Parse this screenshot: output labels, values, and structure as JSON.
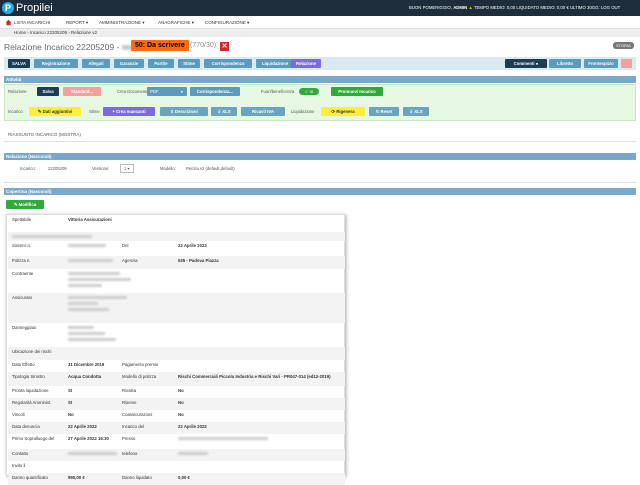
{
  "app": {
    "brand": "Propilei",
    "user_area": "BUON POMERIGGIO,",
    "user_name": "ADMIN",
    "stats": "TEMPO MEDIO: 0,00 LIQUIDATO MEDIO: 0,00 € ULTIMO 30GG:",
    "logout": "LOG OUT"
  },
  "nav": {
    "items": [
      "LISTA INCARICHI",
      "REPORT",
      "AMMINISTRAZIONE",
      "ANAGRAFICHE",
      "CONFIGURAZIONE"
    ]
  },
  "breadcrumb": "Home › Incarico 22205209 › Relazione v2",
  "title": {
    "prefix": "Relazione Incarico 22205209 -",
    "status": "50: Da scrivere",
    "ratio": "(770/30)",
    "storia": "STORIA"
  },
  "tabs": {
    "items": [
      "SALVA",
      "Registrazione",
      "Allegati",
      "Garanzie",
      "Partite",
      "Stime",
      "Corrispondenza",
      "Liquidazione",
      "Relazione"
    ],
    "right": [
      "Commenti",
      "Libretto",
      "Frontespizio"
    ]
  },
  "sections": {
    "attivita": "Attività",
    "riassunto": "RIASSUNTO INCARICO (MOSTRA)",
    "relazione": "Relazione (Nascondi)",
    "copertina": "Copertina (Nascondi)"
  },
  "attivita": {
    "relazione_label": "Relazione",
    "salva": "Salva",
    "standard": "Standard...",
    "crea_doc_label": "Crea Documento",
    "format": "PDF",
    "corrispondenza": "Corrispondenza...",
    "fuori_label": "Fuori/beneficenza",
    "toggle": "SI",
    "promuovi": "Promuovi Incarico",
    "incarico_label": "Incarico",
    "dati_aggiunti": "Dati aggiuntivi",
    "stime_label": "Stime",
    "crea_mancanti": "+ Crea mancanti",
    "descrizioni": "Descrizioni",
    "xls": "XLS",
    "ricavi": "Ricavi/ IVA",
    "liquidazione_label": "Liquidazione",
    "rigenera": "Rigenera",
    "reset": "Reset",
    "xls2": "XLS"
  },
  "relazione": {
    "incarico_label": "Incarico:",
    "incarico_value": "22205209",
    "versione_label": "Versione:",
    "versione_value": "1",
    "modello_label": "Modello:",
    "modello_value": "Perizia v2 (default,default)"
  },
  "modifica": "Modifica",
  "card": {
    "rows": [
      {
        "a": "Spettabile",
        "b": "Vittoria Assicurazioni",
        "c": "",
        "d": ""
      },
      {
        "a": "",
        "b": "",
        "c": "",
        "d": ""
      },
      {
        "a": "Sinistro n.",
        "b": "",
        "c": "Del",
        "d": "22 Aprile 2022"
      },
      {
        "a": "Polizza n.",
        "b": "",
        "c": "Agenzia",
        "d": "535 - Padova Piazza"
      },
      {
        "a": "Contraente",
        "b": "",
        "c": "",
        "d": ""
      },
      {
        "a": "Assicurato",
        "b": "",
        "c": "",
        "d": ""
      },
      {
        "a": "Danneggiato",
        "b": "",
        "c": "",
        "d": ""
      },
      {
        "a": "Ubicazione dei rischi",
        "b": "",
        "c": "",
        "d": ""
      },
      {
        "a": "Data Effetto",
        "b": "31 Dicembre 2019",
        "c": "Pagamento premio",
        "d": ""
      },
      {
        "a": "Tipologia Sinistro",
        "b": "Acqua Condotta",
        "c": "Modello di polizza",
        "d": "Rischi Commerciali Piccola Industria e Rischi Vari - PR047-014 (ed12-2019)"
      },
      {
        "a": "Pronta liquidazione",
        "b": "SI",
        "c": "Rivalsa",
        "d": "No"
      },
      {
        "a": "Regolarità Amminist.",
        "b": "SI",
        "c": "Riserve",
        "d": "No"
      },
      {
        "a": "Vincoli",
        "b": "No",
        "c": "Coassicurazioni",
        "d": "No"
      },
      {
        "a": "Data denuncia",
        "b": "22 Aprile 2022",
        "c": "Incarico del",
        "d": "22 Aprile 2022"
      },
      {
        "a": "Primo Sopralluogo del",
        "b": "27 Aprile 2022 16:30",
        "c": "Presso",
        "d": ""
      },
      {
        "a": "Contatto",
        "b": "",
        "c": "telefono",
        "d": ""
      },
      {
        "a": "Invito il",
        "b": "",
        "c": "",
        "d": ""
      },
      {
        "a": "Danno quantificato",
        "b": "990,00 €",
        "c": "Danno liquidato",
        "d": "0,00 €"
      }
    ]
  }
}
